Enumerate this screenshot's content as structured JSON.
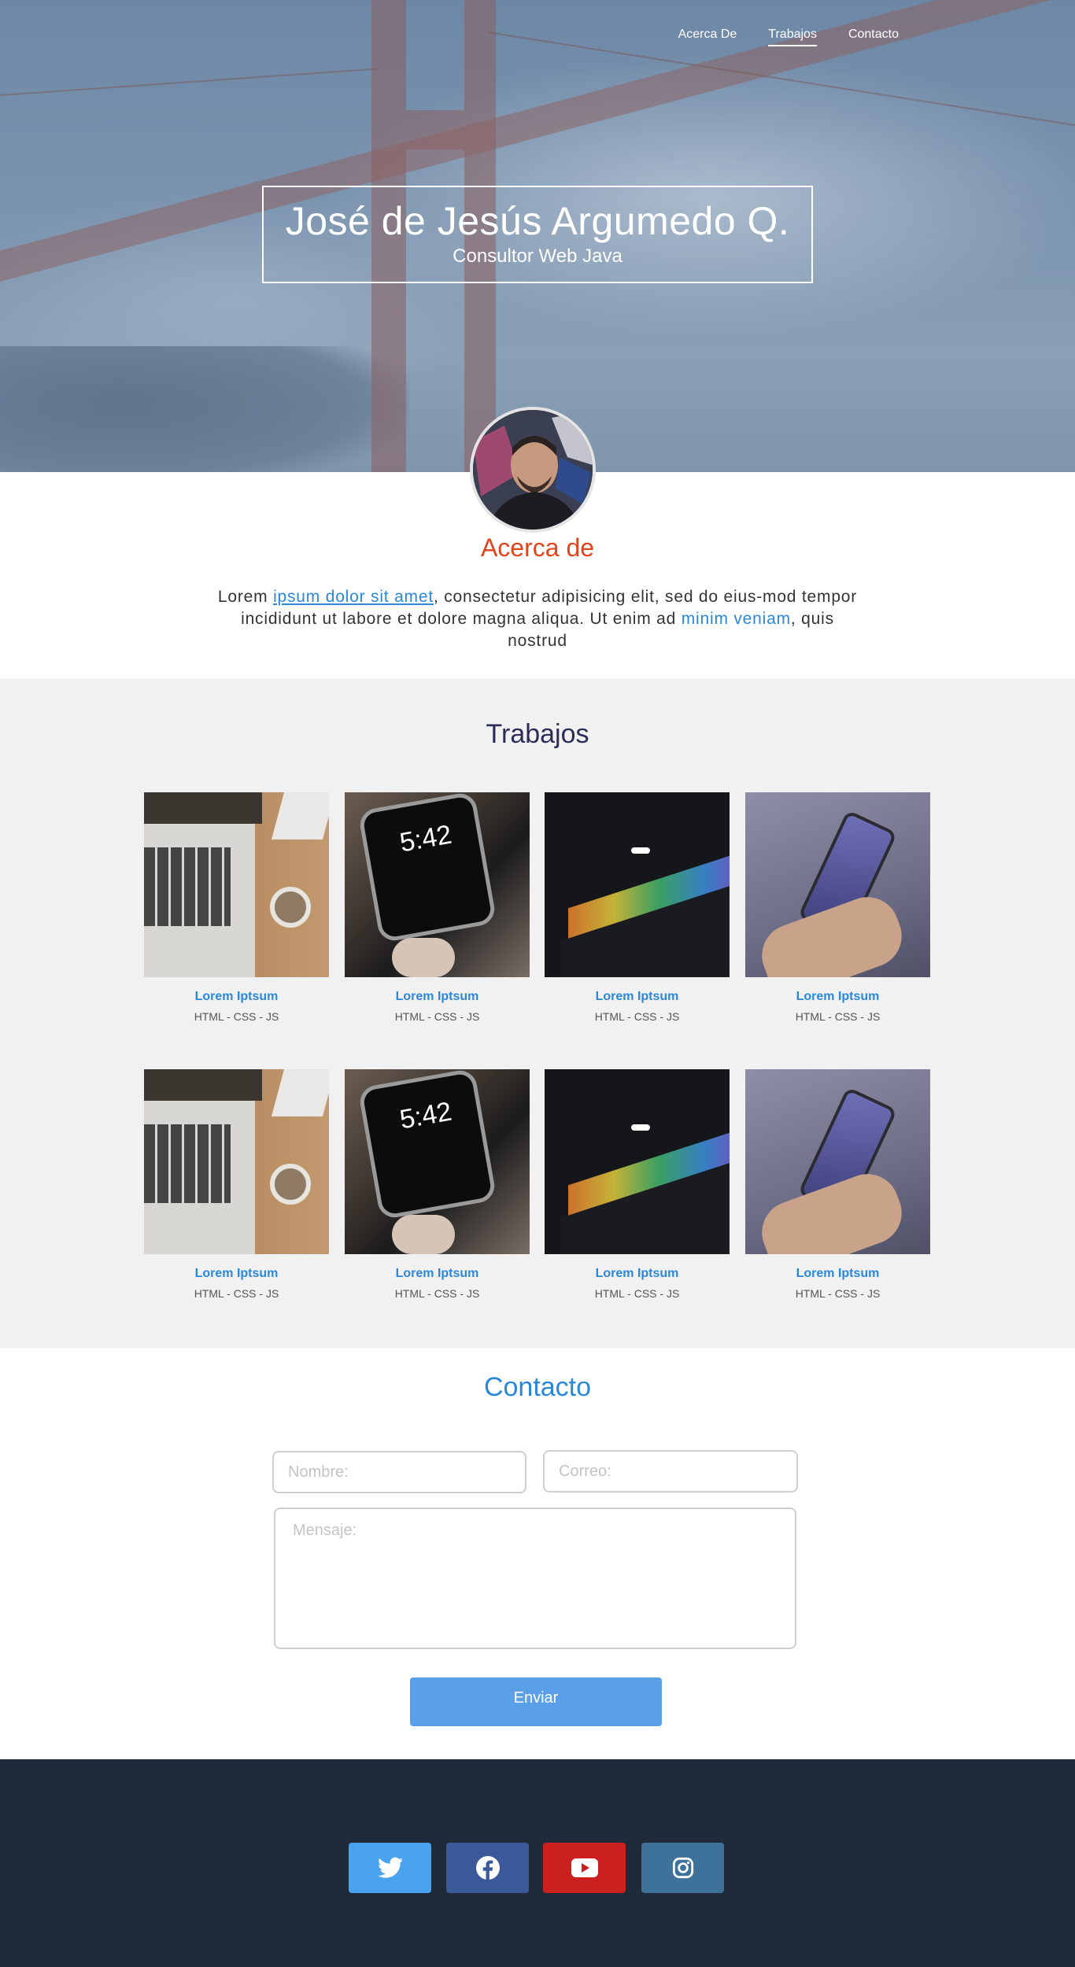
{
  "nav": {
    "items": [
      {
        "label": "Acerca De",
        "active": false
      },
      {
        "label": "Trabajos",
        "active": true
      },
      {
        "label": "Contacto",
        "active": false
      }
    ]
  },
  "hero": {
    "name": "José de Jesús Argumedo Q.",
    "subtitle": "Consultor Web Java"
  },
  "about": {
    "heading": "Acerca de",
    "text_before": "Lorem ",
    "link1": "ipsum dolor sit amet",
    "text_middle": ", consectetur adipisicing elit, sed do eius-mod tempor incididunt ut labore et dolore magna aliqua. Ut enim ad ",
    "link2": "minim veniam",
    "text_after": ", quis nostrud"
  },
  "works": {
    "heading": "Trabajos",
    "items": [
      {
        "title": "Lorem Iptsum",
        "tags": "HTML - CSS - JS",
        "image": "laptop-coffee"
      },
      {
        "title": "Lorem Iptsum",
        "tags": "HTML - CSS - JS",
        "image": "smartwatch"
      },
      {
        "title": "Lorem Iptsum",
        "tags": "HTML - CSS - JS",
        "image": "macbook-dark"
      },
      {
        "title": "Lorem Iptsum",
        "tags": "HTML - CSS - JS",
        "image": "phone-hand"
      },
      {
        "title": "Lorem Iptsum",
        "tags": "HTML - CSS - JS",
        "image": "laptop-coffee"
      },
      {
        "title": "Lorem Iptsum",
        "tags": "HTML - CSS - JS",
        "image": "smartwatch"
      },
      {
        "title": "Lorem Iptsum",
        "tags": "HTML - CSS - JS",
        "image": "macbook-dark"
      },
      {
        "title": "Lorem Iptsum",
        "tags": "HTML - CSS - JS",
        "image": "phone-hand"
      }
    ]
  },
  "contact": {
    "heading": "Contacto",
    "name_placeholder": "Nombre:",
    "email_placeholder": "Correo:",
    "message_placeholder": "Mensaje:",
    "submit_label": "Enviar"
  },
  "footer": {
    "social": [
      {
        "name": "twitter-icon",
        "color": "#4aa3ef"
      },
      {
        "name": "facebook-icon",
        "color": "#3b5998"
      },
      {
        "name": "youtube-icon",
        "color": "#cc1f1f"
      },
      {
        "name": "instagram-icon",
        "color": "#3f729b"
      }
    ]
  },
  "colors": {
    "accent_blue": "#2b87d8",
    "about_heading": "#e0451f",
    "works_heading": "#2c2c5a",
    "footer_bg": "#1f2a3a",
    "button_bg": "#5aa0e8"
  }
}
